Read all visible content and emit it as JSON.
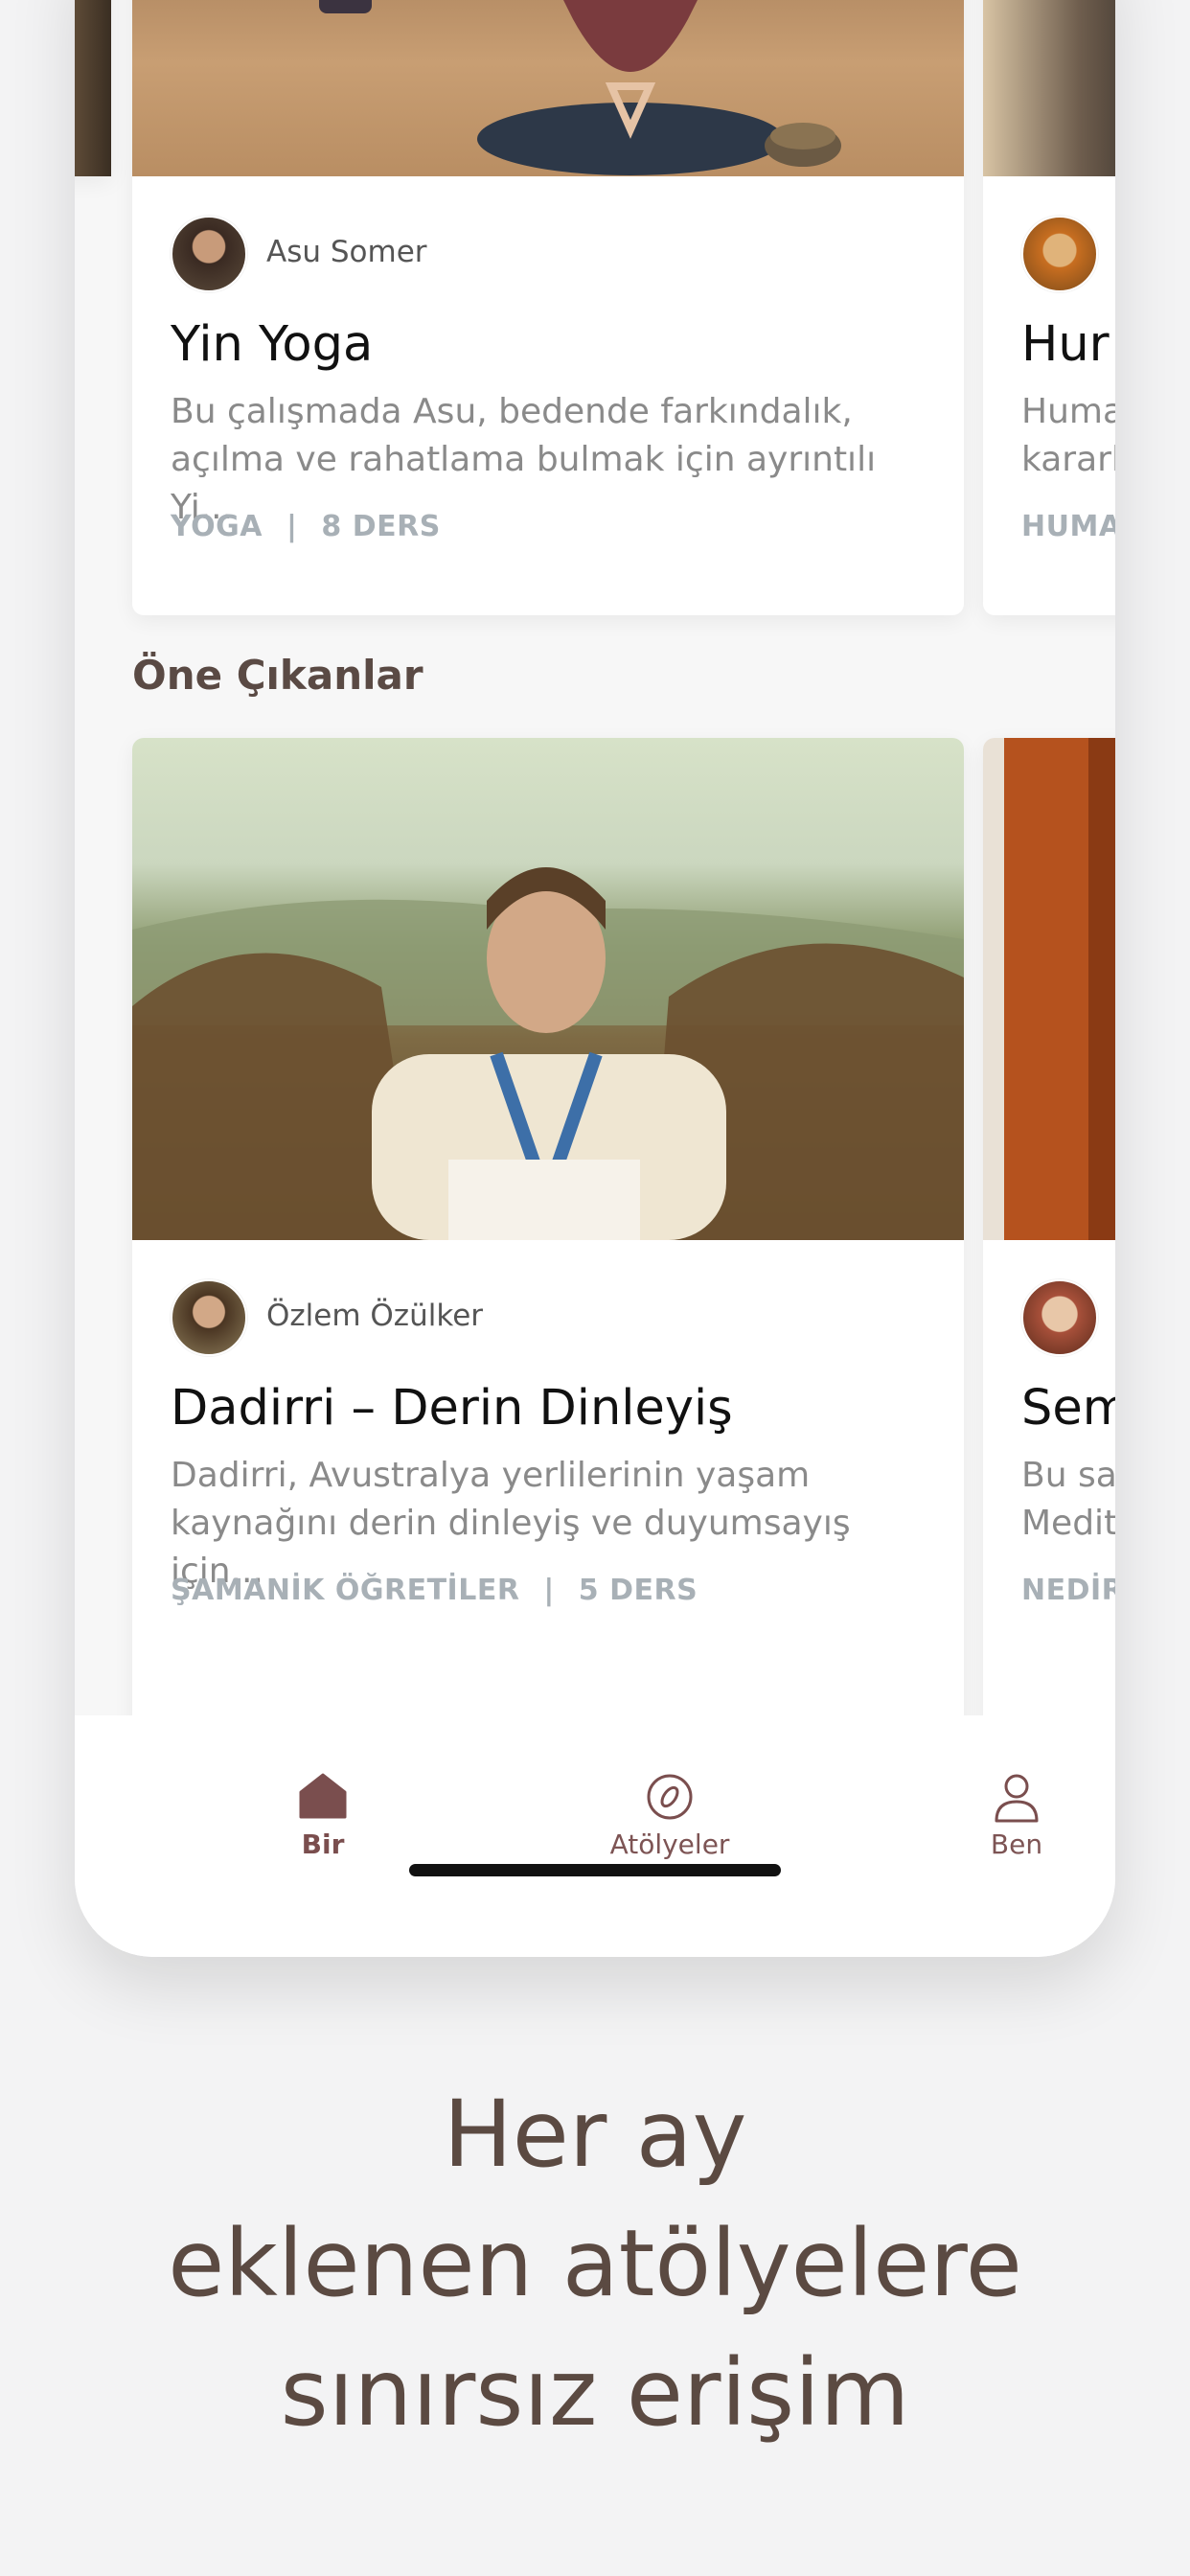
{
  "cards_top": {
    "left_peek": {},
    "main": {
      "author": "Asu Somer",
      "title": "Yin Yoga",
      "description": "Bu çalışmada Asu, bedende farkındalık, açılma ve rahatlama bulmak için ayrıntılı Yi...",
      "category": "YOGA",
      "lessons": "8 DERS"
    },
    "right_peek": {
      "title": "Hur",
      "description_line1": "Huma",
      "description_line2": "kararl",
      "category": "HUMA"
    }
  },
  "section": {
    "title": "Öne Çıkanlar"
  },
  "cards_featured": {
    "main": {
      "author": "Özlem Özülker",
      "title": "Dadirri – Derin Dinleyiş",
      "description": "Dadirri, Avustralya yerlilerinin yaşam kaynağını derin dinleyiş ve duyumsayış için...",
      "category": "ŞAMANİK ÖĞRETİLER",
      "lessons": "5 DERS"
    },
    "right_peek": {
      "title": "Sem",
      "description_line1": "Bu sa",
      "description_line2": "Medit",
      "category": "NEDİR"
    }
  },
  "separator": "|",
  "tabbar": {
    "items": [
      {
        "label": "Bir",
        "icon": "home-icon",
        "active": true
      },
      {
        "label": "Atölyeler",
        "icon": "workshops-icon",
        "active": false
      },
      {
        "label": "Ben",
        "icon": "profile-icon",
        "active": false
      }
    ]
  },
  "headline": {
    "line1": "Her ay",
    "line2": "eklenen atölyelere",
    "line3": "sınırsız erişim"
  },
  "colors": {
    "accent": "#7a4e4e",
    "meta": "#a8b0b6",
    "headline": "#5b4a42",
    "background": "#f3f3f4"
  }
}
